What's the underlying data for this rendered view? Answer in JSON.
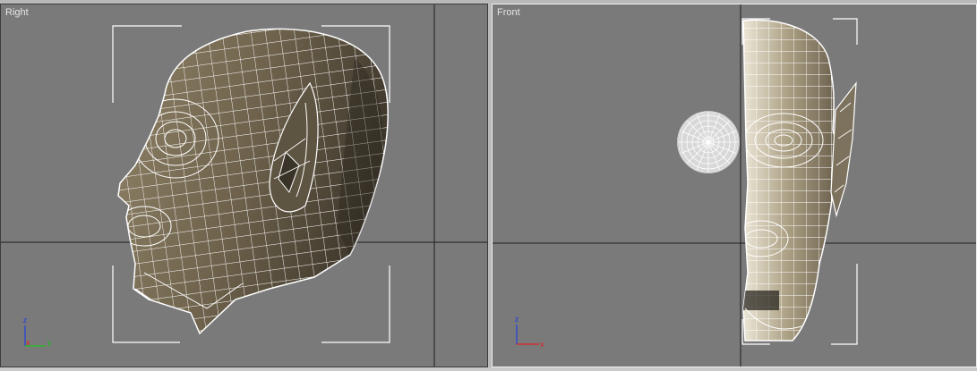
{
  "viewports": {
    "right": {
      "label": "Right",
      "axis": {
        "z": "z",
        "x": "x",
        "y": "y"
      }
    },
    "front": {
      "label": "Front",
      "axis": {
        "z": "z",
        "x": "x"
      }
    }
  },
  "colors": {
    "viewport_bg": "#7a7a7a",
    "grid_line": "#1e1e1e",
    "wireframe": "#ffffff",
    "mesh_fill": "#6a5f4d",
    "axis_x": "#e02020",
    "axis_y": "#20c020",
    "axis_z": "#2040e0",
    "active_border": "#f0f0f0"
  }
}
